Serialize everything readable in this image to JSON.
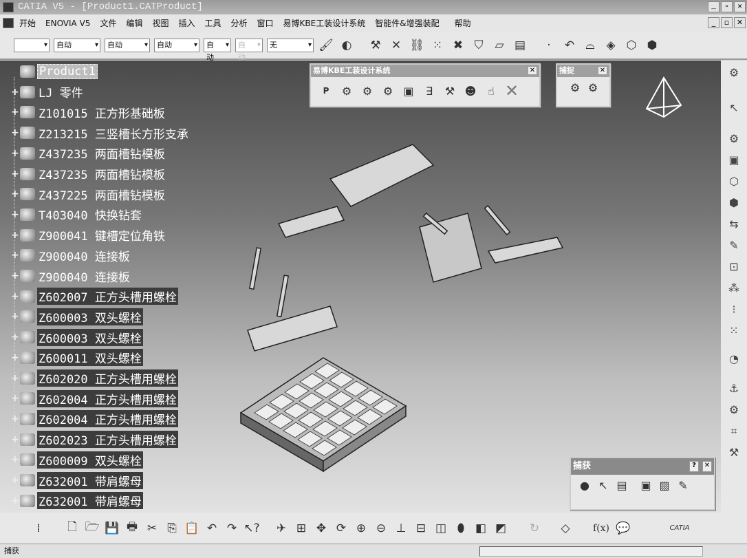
{
  "window": {
    "title": "CATIA V5 - [Product1.CATProduct]",
    "controls": [
      "_",
      "▫",
      "✕"
    ]
  },
  "menu": [
    "开始",
    "ENOVIA V5",
    "文件",
    "编辑",
    "视图",
    "插入",
    "工具",
    "分析",
    "窗口",
    "易博KBE工装设计系统",
    "智能件&增强装配",
    "帮助"
  ],
  "toolbar": {
    "combos": [
      "",
      "自动",
      "自动",
      "自动",
      "自动",
      "自动",
      "无"
    ]
  },
  "tree": {
    "root": "Product1",
    "items": [
      "LJ 零件",
      "Z101015 正方形基础板",
      "Z213215 三竖槽长方形支承",
      "Z437235 两面槽钻模板",
      "Z437235 两面槽钻模板",
      "Z437225 两面槽钻模板",
      "T403040 快换钻套",
      "Z900041 键槽定位角铁",
      "Z900040 连接板",
      "Z900040 连接板",
      "Z602007 正方头槽用螺栓",
      "Z600003 双头螺栓",
      "Z600003 双头螺栓",
      "Z600011 双头螺栓",
      "Z602020 正方头槽用螺栓",
      "Z602004 正方头槽用螺栓",
      "Z602004 正方头槽用螺栓",
      "Z602023 正方头槽用螺栓",
      "Z600009 双头螺栓",
      "Z632001 带肩螺母",
      "Z632001 带肩螺母"
    ]
  },
  "kbe_toolbar": {
    "title": "易博KBE工装设计系统",
    "first_button": "P"
  },
  "snap_toolbar": {
    "title": "捕捉"
  },
  "capture_toolbar": {
    "title": "捕获",
    "help": "?"
  },
  "bottom_toolbar": {
    "formula": "f(x)"
  },
  "logo": "CATIA",
  "status": {
    "text": "捕获"
  }
}
